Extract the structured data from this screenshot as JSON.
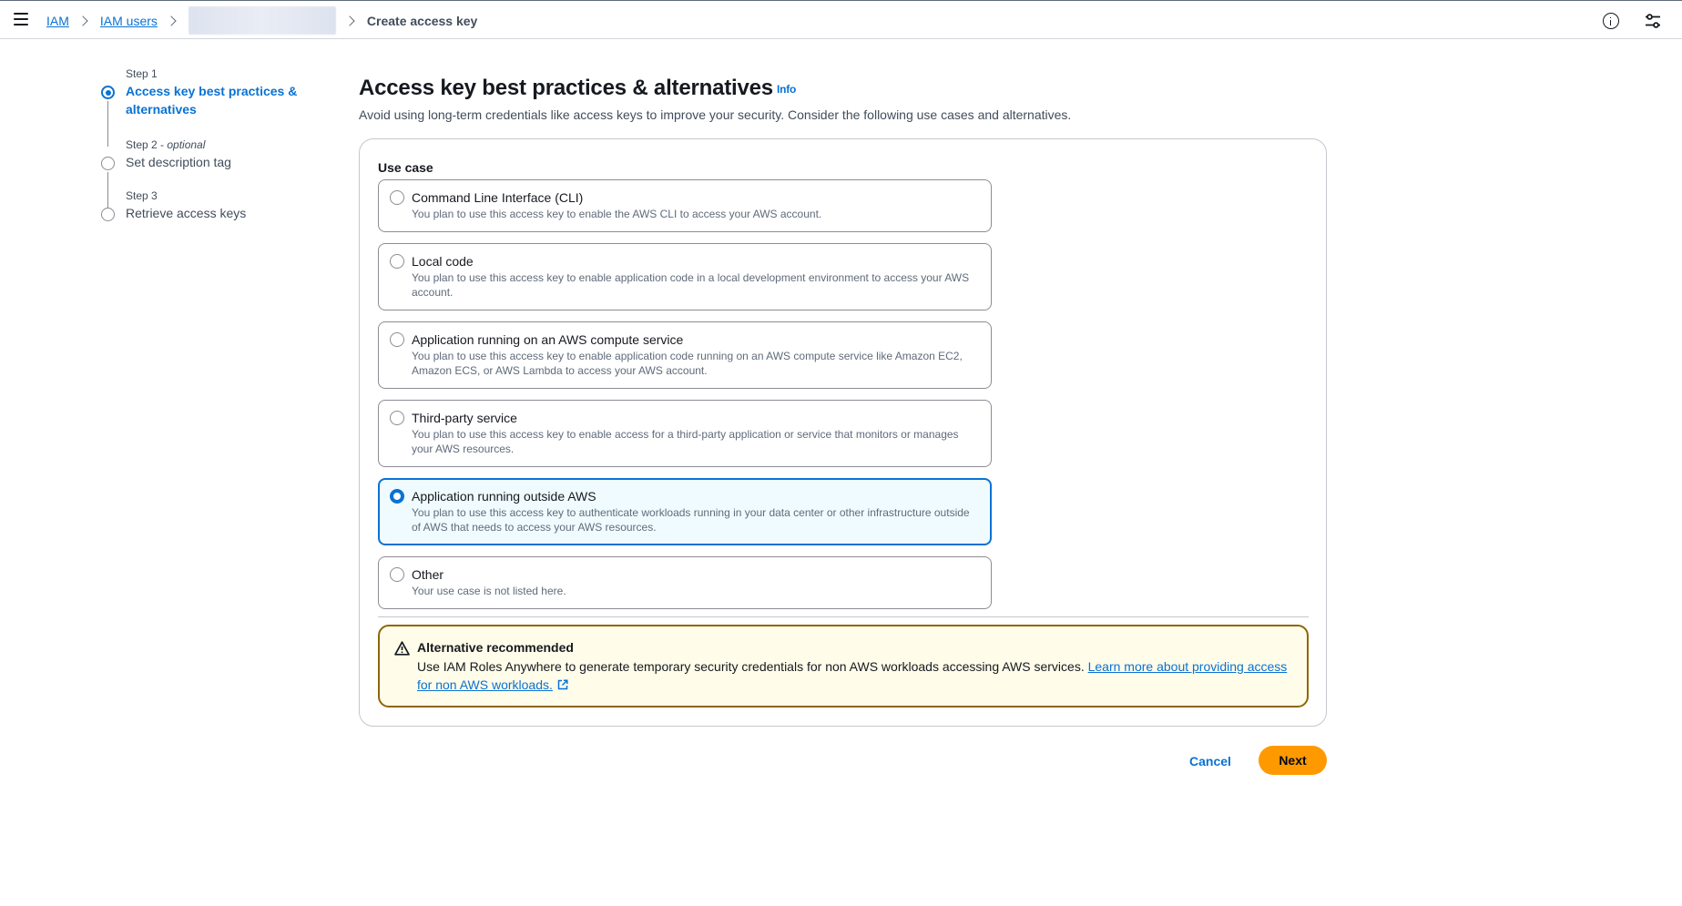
{
  "topbar": {
    "breadcrumbs": [
      {
        "label": "IAM"
      },
      {
        "label": "IAM users"
      }
    ],
    "current": "Create access key"
  },
  "steps": [
    {
      "meta": "Step 1",
      "optional": "",
      "title": "Access key best practices & alternatives",
      "active": true
    },
    {
      "meta": "Step 2 - ",
      "optional": "optional",
      "title": "Set description tag",
      "active": false
    },
    {
      "meta": "Step 3",
      "optional": "",
      "title": "Retrieve access keys",
      "active": false
    }
  ],
  "header": {
    "title": "Access key best practices & alternatives",
    "info_label": "Info",
    "description": "Avoid using long-term credentials like access keys to improve your security. Consider the following use cases and alternatives."
  },
  "use_case": {
    "label": "Use case",
    "selected_index": 4,
    "options": [
      {
        "title": "Command Line Interface (CLI)",
        "description": "You plan to use this access key to enable the AWS CLI to access your AWS account."
      },
      {
        "title": "Local code",
        "description": "You plan to use this access key to enable application code in a local development environment to access your AWS account."
      },
      {
        "title": "Application running on an AWS compute service",
        "description": "You plan to use this access key to enable application code running on an AWS compute service like Amazon EC2, Amazon ECS, or AWS Lambda to access your AWS account."
      },
      {
        "title": "Third-party service",
        "description": "You plan to use this access key to enable access for a third-party application or service that monitors or manages your AWS resources."
      },
      {
        "title": "Application running outside AWS",
        "description": "You plan to use this access key to authenticate workloads running in your data center or other infrastructure outside of AWS that needs to access your AWS resources."
      },
      {
        "title": "Other",
        "description": "Your use case is not listed here."
      }
    ]
  },
  "alert": {
    "title": "Alternative recommended",
    "body": "Use IAM Roles Anywhere to generate temporary security credentials for non AWS workloads accessing AWS services. ",
    "link": "Learn more about providing access for non AWS workloads."
  },
  "actions": {
    "cancel": "Cancel",
    "next": "Next"
  },
  "colors": {
    "accent": "#0972d3",
    "primary_button": "#ff9900",
    "warning_border": "#8d6605",
    "warning_bg": "#fffce9"
  }
}
